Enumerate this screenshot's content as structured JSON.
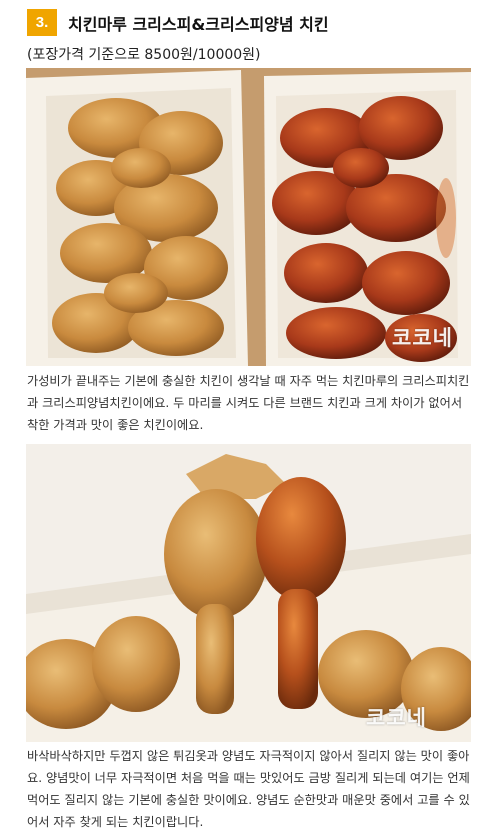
{
  "section": {
    "number": "3.",
    "title": "치킨마루 크리스피&크리스피양념 치킨",
    "subtitle": "(포장가격 기준으로 8500원/10000원)"
  },
  "photo1": {
    "watermark": "코코네",
    "description_icon": "fried-chicken-boxes-photo"
  },
  "paragraph1": {
    "lines": [
      "가성비가 끝내주는 기본에 충실한 치킨이 생각날 때 자주 먹는 치킨마루의 크리스피치킨",
      "과 크리스피양념치킨이에요. 두 마리를 시켜도 다른 브랜드 치킨과 크게 차이가 없어서",
      "착한 가격과 맛이 좋은 치킨이에요."
    ]
  },
  "photo2": {
    "watermark": "코코네",
    "description_icon": "chicken-drumsticks-photo"
  },
  "paragraph2": {
    "lines": [
      "바삭바삭하지만 두껍지 않은 튀김옷과 양념도 자극적이지 않아서 질리지 않는 맛이 좋아",
      "요. 양념맛이 너무 자극적이면 처음 먹을 때는 맛있어도 금방 질리게 되는데 여기는 언제",
      "먹어도 질리지 않는 기본에 충실한 맛이에요. 양념도 순한맛과 매운맛 중에서 고를 수 있",
      "어서 자주 찾게 되는 치킨이랍니다."
    ]
  },
  "colors": {
    "badge": "#f0a500",
    "fried_chicken": "#c98a3e",
    "sauced_chicken": "#a8391a",
    "box": "#f6f1e8"
  }
}
